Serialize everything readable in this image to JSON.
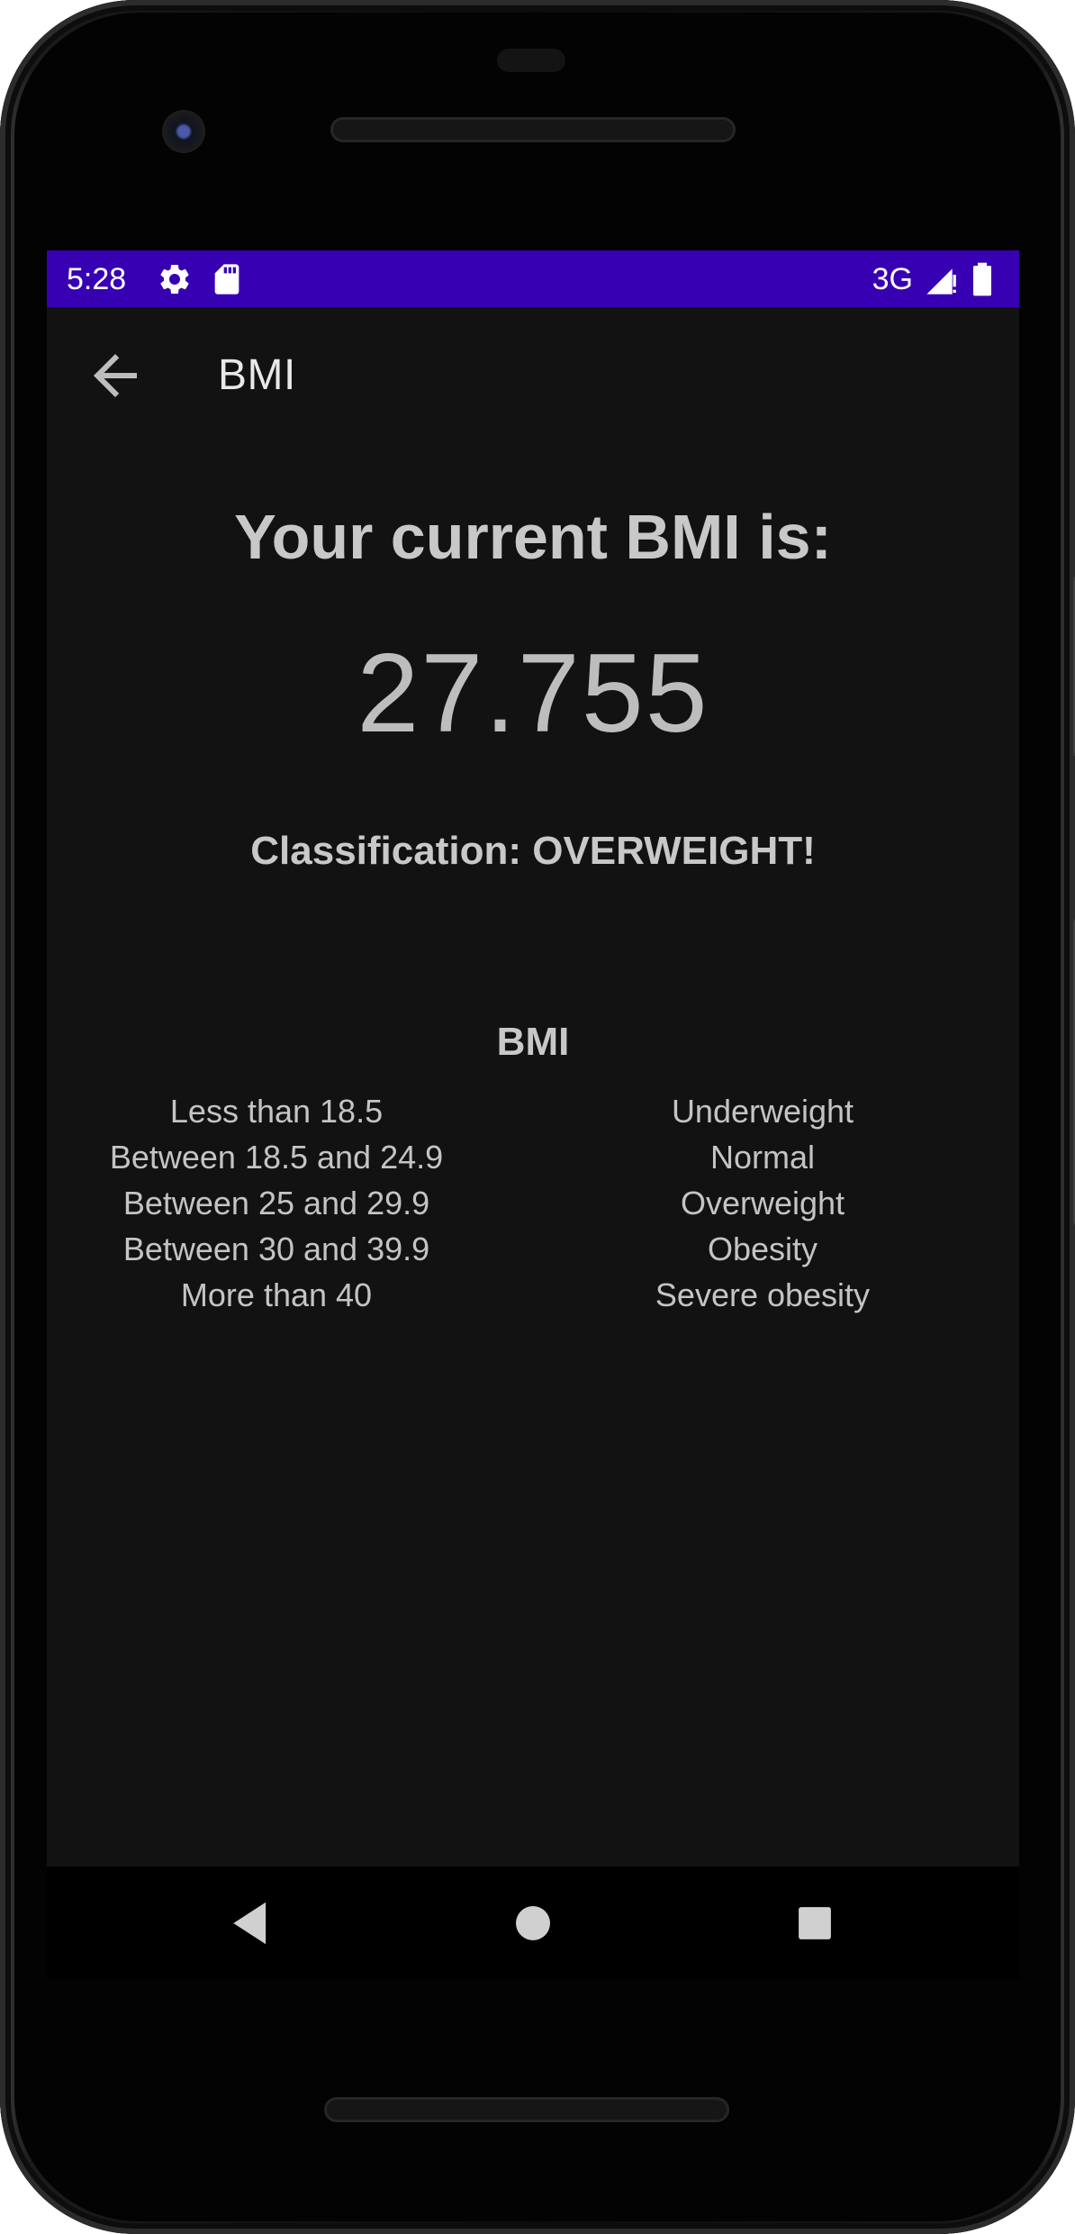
{
  "status_bar": {
    "time": "5:28",
    "network": "3G",
    "icons": [
      "gear-icon",
      "sd-card-icon",
      "signal-icon",
      "battery-icon"
    ],
    "background_color": "#3700b3"
  },
  "app_bar": {
    "title": "BMI",
    "back_icon": "arrow-back-icon"
  },
  "result": {
    "headline": "Your current BMI is:",
    "value": "27.755",
    "classification": "Classification: OVERWEIGHT!"
  },
  "bmi_table": {
    "title": "BMI",
    "rows": [
      {
        "range": "Less than 18.5",
        "class": "Underweight"
      },
      {
        "range": "Between 18.5 and 24.9",
        "class": "Normal"
      },
      {
        "range": "Between 25 and 29.9",
        "class": "Overweight"
      },
      {
        "range": "Between 30 and 39.9",
        "class": "Obesity"
      },
      {
        "range": "More than 40",
        "class": "Severe obesity"
      }
    ]
  },
  "nav_bar": {
    "buttons": [
      "back-triangle-icon",
      "home-circle-icon",
      "recents-square-icon"
    ]
  },
  "colors": {
    "screen_background": "#121212",
    "text_primary": "#c8c8c8"
  }
}
